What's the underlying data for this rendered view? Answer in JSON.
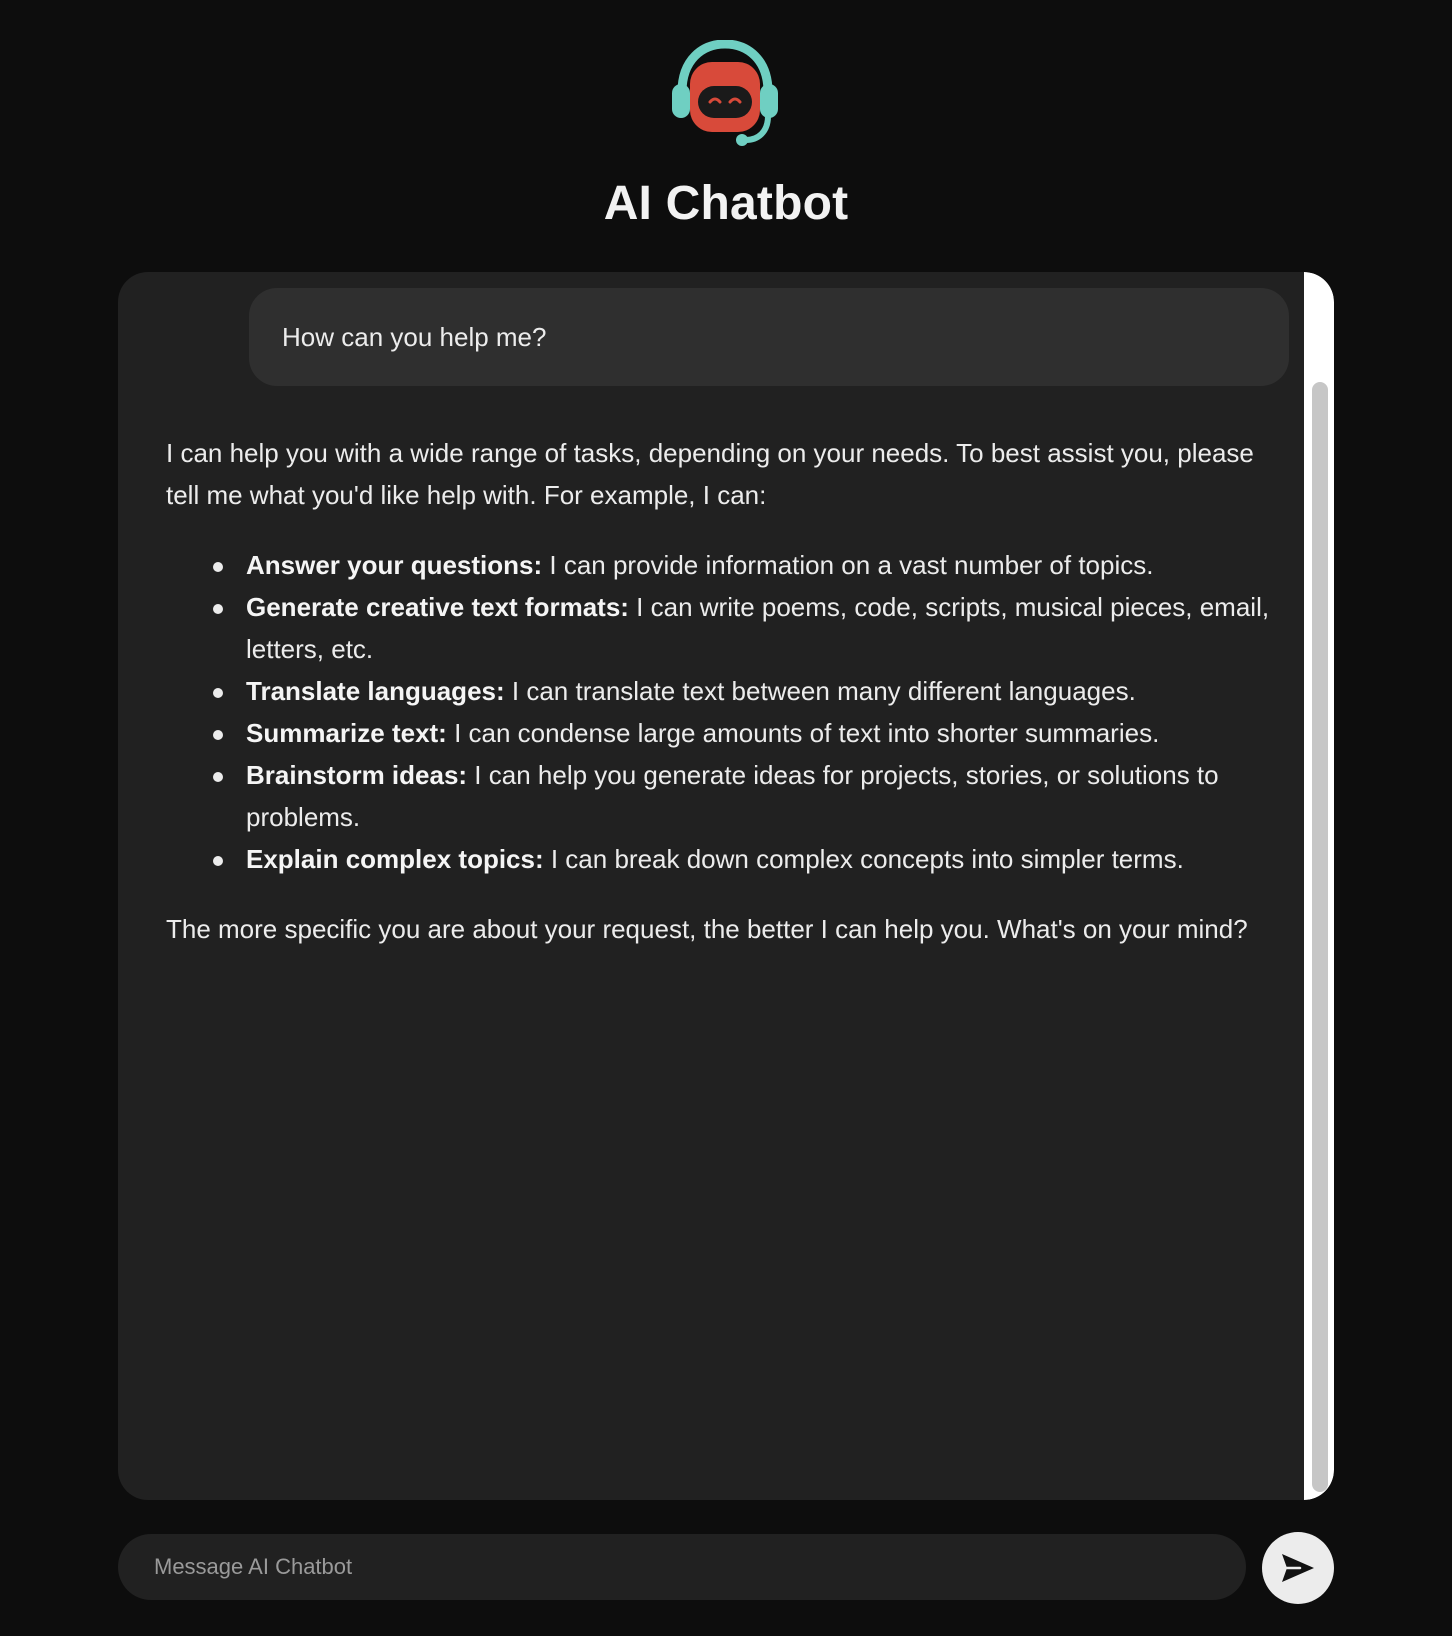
{
  "app": {
    "title": "AI Chatbot",
    "logo_icon": "robot-headset-icon",
    "colors": {
      "background": "#0d0d0d",
      "panel": "#212121",
      "bubble": "#2f2f2f",
      "accent_teal": "#6fcfc2",
      "accent_red": "#d84a3a"
    }
  },
  "conversation": {
    "user_message": "How can you help me?",
    "bot_reply": {
      "intro": "I can help you with a wide range of tasks, depending on your needs. To best assist you, please tell me what you'd like help with. For example, I can:",
      "items": [
        {
          "title": "Answer your questions:",
          "text": " I can provide information on a vast number of topics."
        },
        {
          "title": "Generate creative text formats:",
          "text": " I can write poems, code, scripts, musical pieces, email, letters, etc."
        },
        {
          "title": "Translate languages:",
          "text": " I can translate text between many different languages."
        },
        {
          "title": "Summarize text:",
          "text": " I can condense large amounts of text into shorter summaries."
        },
        {
          "title": "Brainstorm ideas:",
          "text": " I can help you generate ideas for projects, stories, or solutions to problems."
        },
        {
          "title": "Explain complex topics:",
          "text": " I can break down complex concepts into simpler terms."
        }
      ],
      "outro": "The more specific you are about your request, the better I can help you. What's on your mind?"
    }
  },
  "composer": {
    "placeholder": "Message AI Chatbot",
    "value": "",
    "send_icon": "send-arrow-icon"
  }
}
